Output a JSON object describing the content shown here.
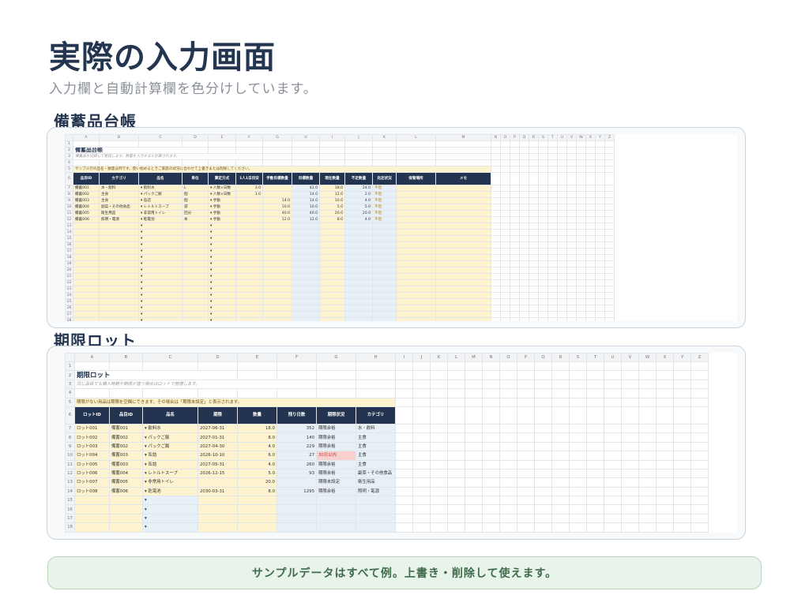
{
  "page": {
    "title": "実際の入力画面",
    "subtitle": "入力欄と自動計算欄を色分けしています。",
    "footer": "サンプルデータはすべて例。上書き・削除して使えます。"
  },
  "sheet1": {
    "section_title": "備蓄品台帳",
    "col_letters": [
      "A",
      "B",
      "C",
      "D",
      "E",
      "F",
      "G",
      "H",
      "I",
      "J",
      "K",
      "L",
      "M",
      "N",
      "O",
      "P",
      "Q",
      "R",
      "S",
      "T",
      "U",
      "V",
      "W",
      "X",
      "Y",
      "Z"
    ],
    "sheet_title": "備蓄品台帳",
    "sheet_subtitle": "備蓄品を記録して管理します。数量を入力すると計算されます。",
    "note": "サンプル行の品名・数量は例です。使い始めるときご家庭の状況に合わせて上書きまたは削除してください。",
    "headers": [
      "品目ID",
      "カテゴリ",
      "品名",
      "単位",
      "算定方式",
      "1人1日目安",
      "手動目標数量",
      "目標数量",
      "現在数量",
      "不足数量",
      "充足状況",
      "保管場所",
      "メモ"
    ],
    "rows": [
      [
        "備蓄001",
        "水・飲料",
        "飲料水",
        "L",
        "人数×日数",
        "3.0",
        "",
        "42.0",
        "18.0",
        "24.0",
        "不足",
        "",
        ""
      ],
      [
        "備蓄002",
        "主食",
        "パックご飯",
        "個",
        "人数×日数",
        "1.0",
        "",
        "14.0",
        "12.0",
        "2.0",
        "不足",
        "",
        ""
      ],
      [
        "備蓄003",
        "主食",
        "缶詰",
        "個",
        "手動",
        "",
        "14.0",
        "14.0",
        "10.0",
        "4.0",
        "不足",
        "",
        ""
      ],
      [
        "備蓄004",
        "副菜・その他食品",
        "レトルトスープ",
        "袋",
        "手動",
        "",
        "10.0",
        "10.0",
        "5.0",
        "5.0",
        "不足",
        "",
        ""
      ],
      [
        "備蓄005",
        "衛生用品",
        "非常用トイレ",
        "回分",
        "手動",
        "",
        "40.0",
        "40.0",
        "20.0",
        "20.0",
        "不足",
        "",
        ""
      ],
      [
        "備蓄006",
        "照明・電源",
        "乾電池",
        "本",
        "手動",
        "",
        "12.0",
        "12.0",
        "8.0",
        "4.0",
        "不足",
        "",
        ""
      ]
    ],
    "empty_row_numbers": [
      "13",
      "14",
      "15",
      "16",
      "17",
      "18",
      "19",
      "20",
      "21",
      "22",
      "23",
      "24",
      "25",
      "26",
      "27",
      "28",
      "29",
      "30",
      "31",
      "32",
      "33",
      "34",
      "35"
    ]
  },
  "sheet2": {
    "section_title": "期限ロット",
    "col_letters": [
      "A",
      "B",
      "C",
      "D",
      "E",
      "F",
      "G",
      "H",
      "I",
      "J",
      "K",
      "L",
      "M",
      "N",
      "O",
      "P",
      "Q",
      "R",
      "S",
      "T",
      "U",
      "V",
      "W",
      "X",
      "Y",
      "Z"
    ],
    "sheet_title": "期限ロット",
    "sheet_subtitle": "同じ品目でも購入時期や期限が違う場合はロットで管理します。",
    "note": "期限がない用品は期限を空欄にできます。その場合は「期限未設定」と表示されます。",
    "headers": [
      "ロットID",
      "品目ID",
      "品名",
      "期限",
      "数量",
      "残り日数",
      "期限状況",
      "カテゴリ"
    ],
    "rows": [
      [
        "ロット001",
        "備蓄001",
        "飲料水",
        "2027-06-31",
        "18.0",
        "352",
        "期限余裕",
        "水・飲料"
      ],
      [
        "ロット002",
        "備蓄002",
        "パックご飯",
        "2027-01-31",
        "8.0",
        "140",
        "期限余裕",
        "主食"
      ],
      [
        "ロット003",
        "備蓄002",
        "パックご飯",
        "2027-04-30",
        "4.0",
        "229",
        "期限余裕",
        "主食"
      ],
      [
        "ロット004",
        "備蓄003",
        "缶詰",
        "2026-10-10",
        "6.0",
        "27",
        "30日以内",
        "主食"
      ],
      [
        "ロット005",
        "備蓄003",
        "缶詰",
        "2027-05-31",
        "4.0",
        "260",
        "期限余裕",
        "主食"
      ],
      [
        "ロット006",
        "備蓄004",
        "レトルトスープ",
        "2026-12-15",
        "5.0",
        "93",
        "期限余裕",
        "副菜・その他食品"
      ],
      [
        "ロット007",
        "備蓄005",
        "非常用トイレ",
        "",
        "20.0",
        "",
        "期限未設定",
        "衛生用品"
      ],
      [
        "ロット008",
        "備蓄006",
        "乾電池",
        "2030-03-31",
        "8.0",
        "1295",
        "期限余裕",
        "照明・電源"
      ]
    ],
    "empty_row_numbers": [
      "15",
      "16",
      "17",
      "18",
      "19",
      "20"
    ]
  }
}
